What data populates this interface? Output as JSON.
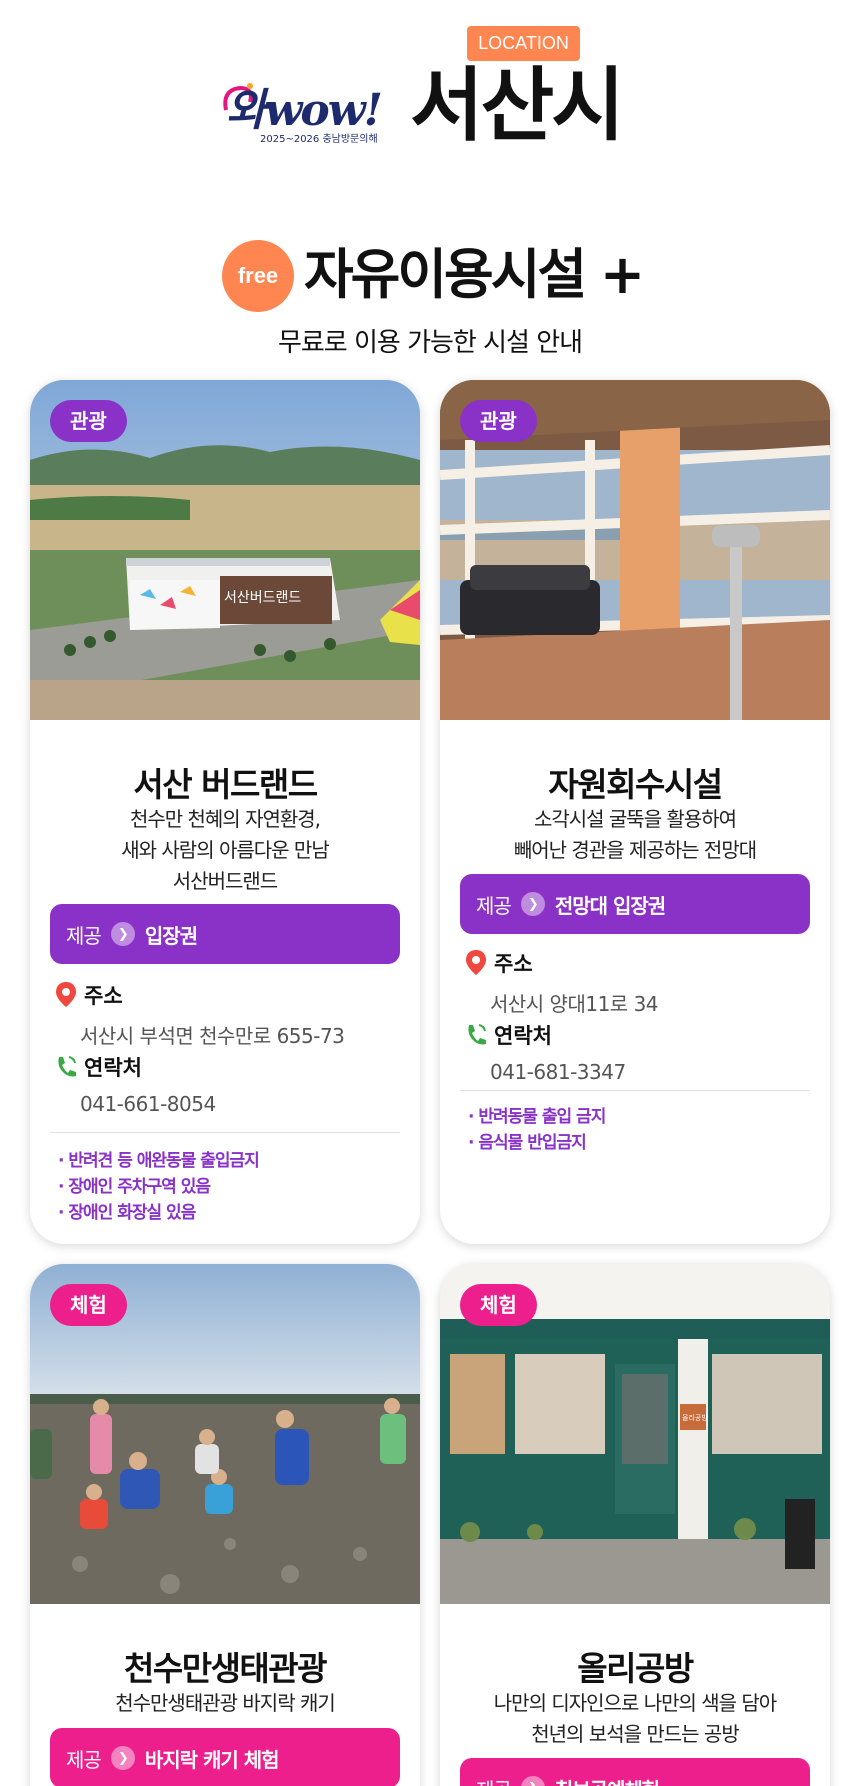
{
  "header": {
    "location_badge": "LOCATION",
    "logo_text": "와wow!",
    "logo_sub": "2025~2026 충남방문의해",
    "city": "서산시"
  },
  "section": {
    "badge": "free",
    "title": "자유이용시설 +",
    "subtitle": "무료로 이용 가능한 시설 안내"
  },
  "labels": {
    "provide": "제공",
    "address": "주소",
    "contact": "연락처"
  },
  "cards": [
    {
      "category": "관광",
      "title": "서산 버드랜드",
      "desc": [
        "천수만 천혜의 자연환경,",
        "새와 사람의 아름다운 만남",
        "서산버드랜드"
      ],
      "provide": "입장권",
      "address": "서산시 부석면 천수만로 655-73",
      "phone": "041-661-8054",
      "notes": [
        "· 반려견 등 애완동물 출입금지",
        "· 장애인 주차구역 있음",
        "· 장애인 화장실 있음"
      ],
      "photo_sign": "서산버드랜드"
    },
    {
      "category": "관광",
      "title": "자원회수시설",
      "desc": [
        "소각시설 굴뚝을 활용하여",
        "빼어난 경관을 제공하는 전망대"
      ],
      "provide": "전망대 입장권",
      "address": "서산시 양대11로 34",
      "phone": "041-681-3347",
      "notes": [
        "· 반려동물 출입 금지",
        "· 음식물 반입금지"
      ]
    },
    {
      "category": "체험",
      "title": "천수만생태관광",
      "desc": [
        "천수만생태관광 바지락 캐기"
      ],
      "provide": "바지락 캐기 체험"
    },
    {
      "category": "체험",
      "title": "올리공방",
      "desc": [
        "나만의 디자인으로 나만의 색을 담아",
        "천년의 보석을 만드는 공방"
      ],
      "provide": "칠보공예체험",
      "photo_sign": "올리공방"
    }
  ],
  "colors": {
    "accent_orange": "#ff8650",
    "purple": "#8a31c7",
    "pink": "#ec1f8d"
  }
}
